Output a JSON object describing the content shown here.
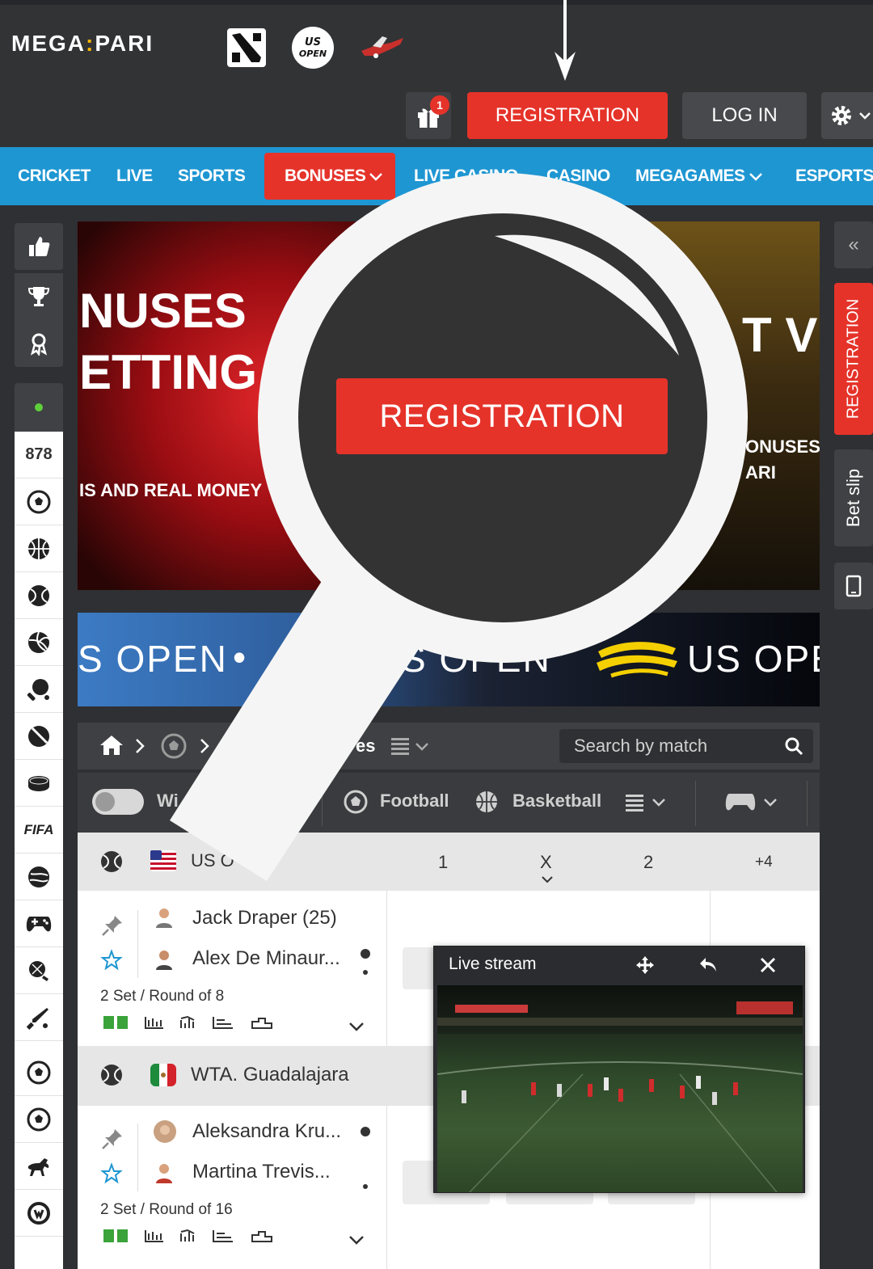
{
  "header": {
    "logo_left": "MEGA",
    "logo_sep": ":",
    "logo_right": "PARI",
    "gift_count": "1",
    "registration": "REGISTRATION",
    "login": "LOG IN",
    "partner_icons": [
      "dota-icon",
      "us-open-icon",
      "airplane-icon"
    ]
  },
  "nav": {
    "items": [
      "CRICKET",
      "LIVE",
      "SPORTS",
      "BONUSES",
      "LIVE CASINO",
      "CASINO",
      "MEGAGAMES",
      "ESPORTS"
    ]
  },
  "left_sidebar": {
    "live_count": "878",
    "fifa_label": "FIFA"
  },
  "banner": {
    "line1": "NUSES",
    "line2": "ETTING",
    "line3": "IS AND REAL MONEY",
    "vip": "T VIP",
    "right1": "ONUSES",
    "right2": "ARI"
  },
  "usopen_strip": {
    "text_a": "S OPEN",
    "dot": "•",
    "text_b": "S OPEN",
    "text_c": "US OPE"
  },
  "right_sidebar": {
    "registration": "REGISTRATION",
    "bet_slip": "Bet slip",
    "collapse": "«"
  },
  "breadcrumb": {
    "partial_label": "es"
  },
  "search": {
    "placeholder": "Search by match"
  },
  "filters": {
    "partial_toggle_label": "Wi",
    "football": "Football",
    "basketball": "Basketball"
  },
  "events": {
    "header": {
      "league": "US O",
      "col1": "1",
      "colx": "X",
      "col2": "2",
      "more": "+4"
    },
    "matches": [
      {
        "player1": "Jack Draper (25)",
        "player2": "Alex De Minaur...",
        "info": "2 Set / Round of 8"
      },
      {
        "league": "WTA. Guadalajara",
        "player1": "Aleksandra Kru...",
        "player2": "Martina Trevis...",
        "info": "2 Set / Round of 16"
      }
    ]
  },
  "live_stream": {
    "title": "Live stream"
  },
  "magnifier": {
    "button": "REGISTRATION"
  },
  "colors": {
    "accent_red": "#e5332a",
    "nav_blue": "#1e96d2",
    "dark_bg": "#2f3033"
  }
}
